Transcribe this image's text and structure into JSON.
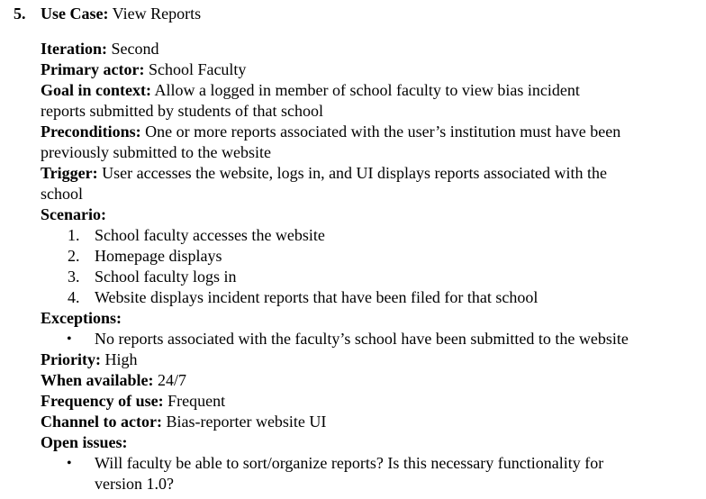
{
  "heading": {
    "number": "5.",
    "label": "Use Case:",
    "value": "View Reports"
  },
  "fields": {
    "iteration": {
      "label": "Iteration:",
      "value": "Second"
    },
    "primary_actor": {
      "label": "Primary actor:",
      "value": "School Faculty"
    },
    "goal": {
      "label": "Goal in context:",
      "line1": "Allow a logged in member of school faculty to view bias incident",
      "line2": "reports submitted by students of that school"
    },
    "preconditions": {
      "label": "Preconditions:",
      "line1": "One or more reports associated with the user’s institution must have been",
      "line2": "previously submitted to the website"
    },
    "trigger": {
      "label": "Trigger:",
      "line1": "User accesses the website, logs in, and UI displays reports associated with the",
      "line2": "school"
    },
    "scenario": {
      "label": "Scenario:",
      "steps": [
        {
          "marker": "1.",
          "text": "School faculty accesses the website"
        },
        {
          "marker": "2.",
          "text": "Homepage displays"
        },
        {
          "marker": "3.",
          "text": "School faculty logs in"
        },
        {
          "marker": "4.",
          "text": "Website displays incident reports that have been filed for that school"
        }
      ]
    },
    "exceptions": {
      "label": "Exceptions:",
      "items": [
        {
          "marker": "•",
          "text": "No reports associated with the faculty’s school have been submitted to the website"
        }
      ]
    },
    "priority": {
      "label": "Priority:",
      "value": "High"
    },
    "when_available": {
      "label": "When available:",
      "value": "24/7"
    },
    "frequency": {
      "label": "Frequency of use:",
      "value": "Frequent"
    },
    "channel": {
      "label": "Channel to actor:",
      "value": "Bias-reporter website UI"
    },
    "open_issues": {
      "label": "Open issues:",
      "items": [
        {
          "marker": "•",
          "line1": "Will faculty be able to sort/organize reports? Is this necessary functionality for",
          "line2": "version 1.0?"
        }
      ]
    }
  }
}
